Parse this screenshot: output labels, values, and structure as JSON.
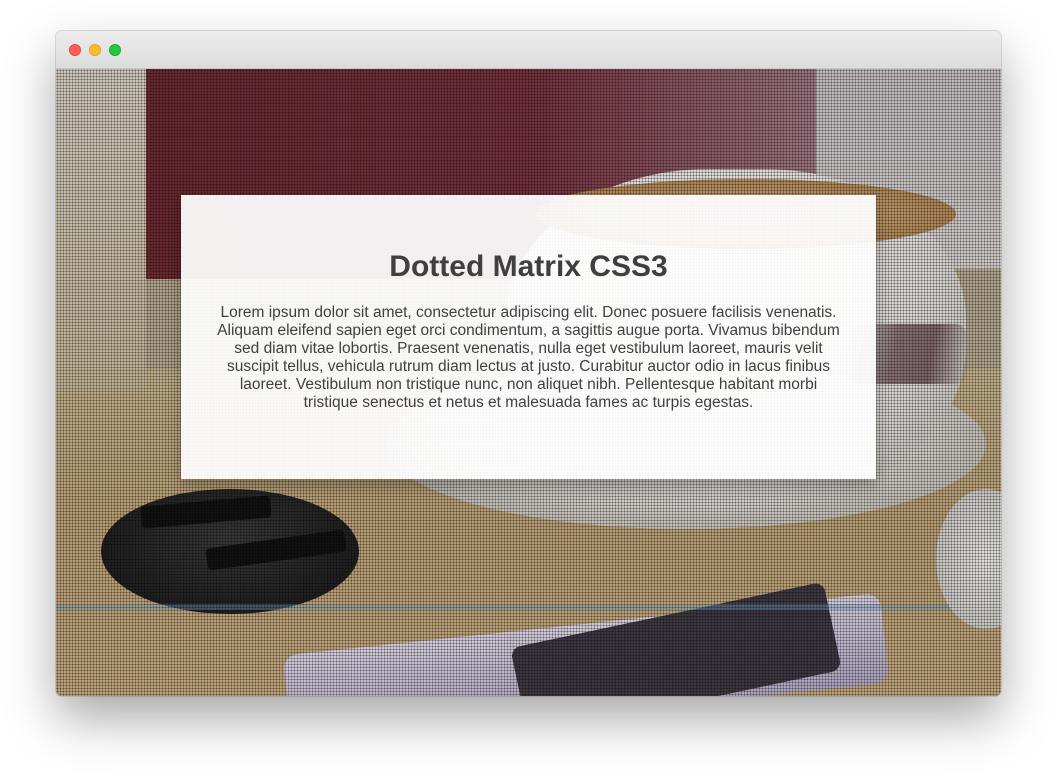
{
  "window": {
    "controls": [
      "close-button",
      "minimize-button",
      "maximize-button"
    ]
  },
  "card": {
    "title": "Dotted Matrix CSS3",
    "body": "Lorem ipsum dolor sit amet, consectetur adipiscing elit. Donec posuere facilisis venenatis. Aliquam eleifend sapien eget orci condimentum, a sagittis augue porta. Vivamus bibendum sed diam vitae lobortis. Praesent venenatis, nulla eget vestibulum laoreet, mauris velit suscipit tellus, vehicula rutrum diam lectus at justo. Curabitur auctor odio in lacus finibus laoreet. Vestibulum non tristique nunc, non aliquet nibh. Pellentesque habitant morbi tristique senectus et netus et malesuada fames ac turpis egestas."
  },
  "colors": {
    "close": "#fc5f57",
    "minimize": "#fdbc2e",
    "maximize": "#28c840",
    "title_text": "#3f3f3f"
  }
}
